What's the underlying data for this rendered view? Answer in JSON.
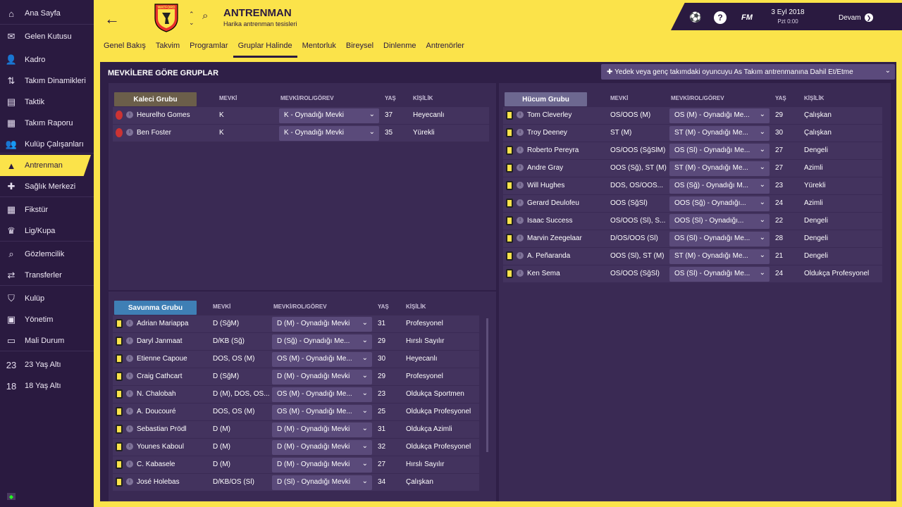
{
  "sidebar": {
    "items": [
      {
        "label": "Ana Sayfa",
        "icon": "home-icon",
        "glyph": "⌂"
      },
      {
        "label": "Gelen Kutusu",
        "icon": "inbox-icon",
        "glyph": "✉"
      },
      {
        "label": "Kadro",
        "icon": "squad-icon",
        "glyph": "👤"
      },
      {
        "label": "Takım Dinamikleri",
        "icon": "dynamics-icon",
        "glyph": "⇅"
      },
      {
        "label": "Taktik",
        "icon": "tactics-icon",
        "glyph": "▤"
      },
      {
        "label": "Takım Raporu",
        "icon": "report-icon",
        "glyph": "▦"
      },
      {
        "label": "Kulüp Çalışanları",
        "icon": "staff-icon",
        "glyph": "👥"
      },
      {
        "label": "Antrenman",
        "icon": "training-icon",
        "glyph": "▲"
      },
      {
        "label": "Sağlık Merkezi",
        "icon": "medical-icon",
        "glyph": "✚"
      },
      {
        "label": "Fikstür",
        "icon": "fixtures-icon",
        "glyph": "▦"
      },
      {
        "label": "Lig/Kupa",
        "icon": "trophy-icon",
        "glyph": "♛"
      },
      {
        "label": "Gözlemcilik",
        "icon": "scouting-icon",
        "glyph": "⌕"
      },
      {
        "label": "Transferler",
        "icon": "transfers-icon",
        "glyph": "⇄"
      },
      {
        "label": "Kulüp",
        "icon": "club-icon",
        "glyph": "⛉"
      },
      {
        "label": "Yönetim",
        "icon": "board-icon",
        "glyph": "▣"
      },
      {
        "label": "Mali Durum",
        "icon": "finances-icon",
        "glyph": "▭"
      },
      {
        "label": "23 Yaş Altı",
        "icon": "u23-icon",
        "glyph": "23"
      },
      {
        "label": "18 Yaş Altı",
        "icon": "u18-icon",
        "glyph": "18"
      }
    ]
  },
  "header": {
    "title": "ANTRENMAN",
    "subtitle": "Harika antrenman tesisleri",
    "crest_text": "WATFORD"
  },
  "topbar": {
    "date": "3 Eyl 2018",
    "time": "Pzt 0:00",
    "continue": "Devam"
  },
  "tabs": [
    "Genel Bakış",
    "Takvim",
    "Programlar",
    "Gruplar Halinde",
    "Mentorluk",
    "Bireysel",
    "Dinlenme",
    "Antrenörler"
  ],
  "panel": {
    "title": "MEVKİLERE GÖRE GRUPLAR",
    "add_button": "Yedek veya genç takımdaki oyuncuyu As Takım antrenmanına Dahil Et/Etme"
  },
  "columns": {
    "position": "MEVKİ",
    "role": "MEVKİ/ROL/GÖREV",
    "age": "YAŞ",
    "personality": "KİŞİLİK"
  },
  "groups": {
    "keepers": {
      "name": "Kaleci Grubu",
      "players": [
        {
          "name": "Heurelho Gomes",
          "pos": "K",
          "role": "K - Oynadığı Mevki",
          "age": "37",
          "pers": "Heyecanlı"
        },
        {
          "name": "Ben Foster",
          "pos": "K",
          "role": "K - Oynadığı Mevki",
          "age": "35",
          "pers": "Yürekli"
        }
      ]
    },
    "attack": {
      "name": "Hücum Grubu",
      "players": [
        {
          "name": "Tom Cleverley",
          "pos": "OS/OOS (M)",
          "role": "OS (M) - Oynadığı Me...",
          "age": "29",
          "pers": "Çalışkan"
        },
        {
          "name": "Troy Deeney",
          "pos": "ST (M)",
          "role": "ST (M) - Oynadığı Me...",
          "age": "30",
          "pers": "Çalışkan"
        },
        {
          "name": "Roberto Pereyra",
          "pos": "OS/OOS (SğSlM)",
          "role": "OS (Sl) - Oynadığı Me...",
          "age": "27",
          "pers": "Dengeli"
        },
        {
          "name": "Andre Gray",
          "pos": "OOS (Sğ), ST (M)",
          "role": "ST (M) - Oynadığı Me...",
          "age": "27",
          "pers": "Azimli"
        },
        {
          "name": "Will Hughes",
          "pos": "DOS, OS/OOS...",
          "role": "OS (Sğ) - Oynadığı M...",
          "age": "23",
          "pers": "Yürekli"
        },
        {
          "name": "Gerard Deulofeu",
          "pos": "OOS (SğSl)",
          "role": "OOS (Sğ) - Oynadığı...",
          "age": "24",
          "pers": "Azimli"
        },
        {
          "name": "Isaac Success",
          "pos": "OS/OOS (Sl), S...",
          "role": "OOS (Sl) - Oynadığı...",
          "age": "22",
          "pers": "Dengeli"
        },
        {
          "name": "Marvin Zeegelaar",
          "pos": "D/OS/OOS (Sl)",
          "role": "OS (Sl) - Oynadığı Me...",
          "age": "28",
          "pers": "Dengeli"
        },
        {
          "name": "A. Peñaranda",
          "pos": "OOS (Sl), ST (M)",
          "role": "ST (M) - Oynadığı Me...",
          "age": "21",
          "pers": "Dengeli"
        },
        {
          "name": "Ken Sema",
          "pos": "OS/OOS (SğSl)",
          "role": "OS (Sl) - Oynadığı Me...",
          "age": "24",
          "pers": "Oldukça Profesyonel"
        }
      ]
    },
    "defence": {
      "name": "Savunma Grubu",
      "players": [
        {
          "name": "Adrian Mariappa",
          "pos": "D (SğM)",
          "role": "D (M) - Oynadığı Mevki",
          "age": "31",
          "pers": "Profesyonel"
        },
        {
          "name": "Daryl Janmaat",
          "pos": "D/KB (Sğ)",
          "role": "D (Sğ) - Oynadığı Me...",
          "age": "29",
          "pers": "Hırslı Sayılır"
        },
        {
          "name": "Etienne Capoue",
          "pos": "DOS, OS (M)",
          "role": "OS (M) - Oynadığı Me...",
          "age": "30",
          "pers": "Heyecanlı"
        },
        {
          "name": "Craig Cathcart",
          "pos": "D (SğM)",
          "role": "D (M) - Oynadığı Mevki",
          "age": "29",
          "pers": "Profesyonel"
        },
        {
          "name": "N. Chalobah",
          "pos": "D (M), DOS, OS...",
          "role": "OS (M) - Oynadığı Me...",
          "age": "23",
          "pers": "Oldukça Sportmen"
        },
        {
          "name": "A. Doucouré",
          "pos": "DOS, OS (M)",
          "role": "OS (M) - Oynadığı Me...",
          "age": "25",
          "pers": "Oldukça Profesyonel"
        },
        {
          "name": "Sebastian Prödl",
          "pos": "D (M)",
          "role": "D (M) - Oynadığı Mevki",
          "age": "31",
          "pers": "Oldukça Azimli"
        },
        {
          "name": "Younes Kaboul",
          "pos": "D (M)",
          "role": "D (M) - Oynadığı Mevki",
          "age": "32",
          "pers": "Oldukça Profesyonel"
        },
        {
          "name": "C. Kabasele",
          "pos": "D (M)",
          "role": "D (M) - Oynadığı Mevki",
          "age": "27",
          "pers": "Hırslı Sayılır"
        },
        {
          "name": "José Holebas",
          "pos": "D/KB/OS (Sl)",
          "role": "D (Sl) - Oynadığı Mevki",
          "age": "34",
          "pers": "Çalışkan"
        }
      ]
    }
  },
  "colors": {
    "yellow": "#fbe34a",
    "navy": "#2a1a40",
    "keeper_head": "#6b5e4a",
    "attack_head": "#6d6890",
    "defence_head": "#3f7fb5"
  }
}
